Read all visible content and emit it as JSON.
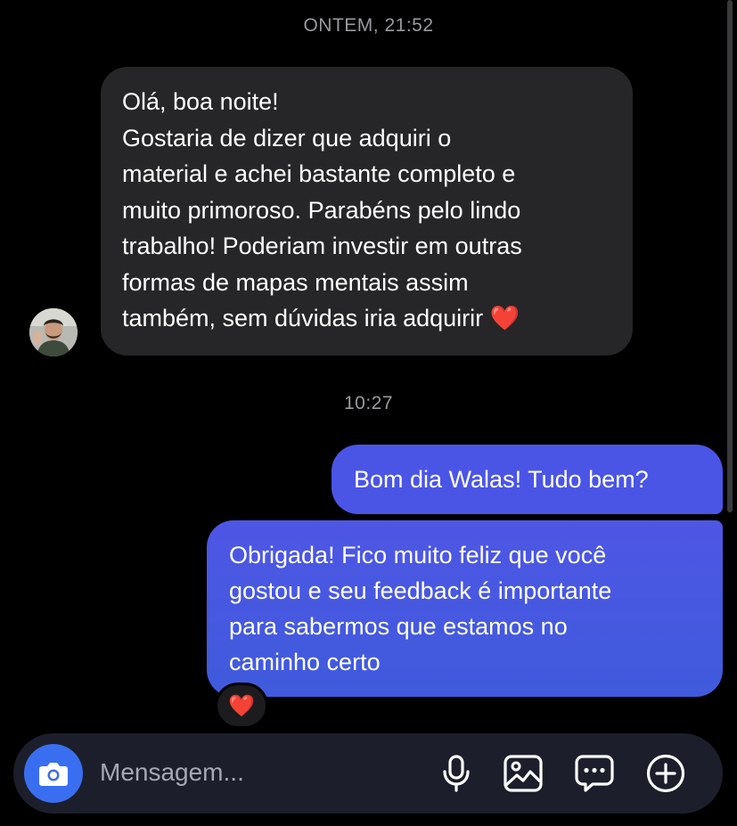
{
  "conversation": {
    "timestamp_1": "ONTEM, 21:52",
    "timestamp_2": "10:27",
    "incoming": {
      "lines": [
        "Olá, boa noite!",
        "Gostaria de dizer que adquiri o",
        "material e achei bastante completo e",
        "muito primoroso. Parabéns pelo lindo",
        "trabalho! Poderiam investir em outras",
        "formas de mapas mentais assim",
        "também, sem dúvidas iria adquirir ❤️"
      ]
    },
    "outgoing_1": "Bom dia Walas! Tudo bem?",
    "outgoing_2": {
      "lines": [
        "Obrigada! Fico muito feliz que você",
        "gostou e seu feedback é importante",
        "para sabermos que estamos no",
        "caminho certo"
      ]
    },
    "reaction": "❤️"
  },
  "composer": {
    "placeholder": "Mensagem...",
    "icons": [
      "camera-icon",
      "microphone-icon",
      "gallery-icon",
      "sticker-icon",
      "plus-icon"
    ]
  },
  "colors": {
    "background": "#000000",
    "incoming_bubble": "#262628",
    "outgoing_bubble": "#4a55e6",
    "camera_button": "#3a6ef0",
    "composer": "#1c1f2b"
  }
}
